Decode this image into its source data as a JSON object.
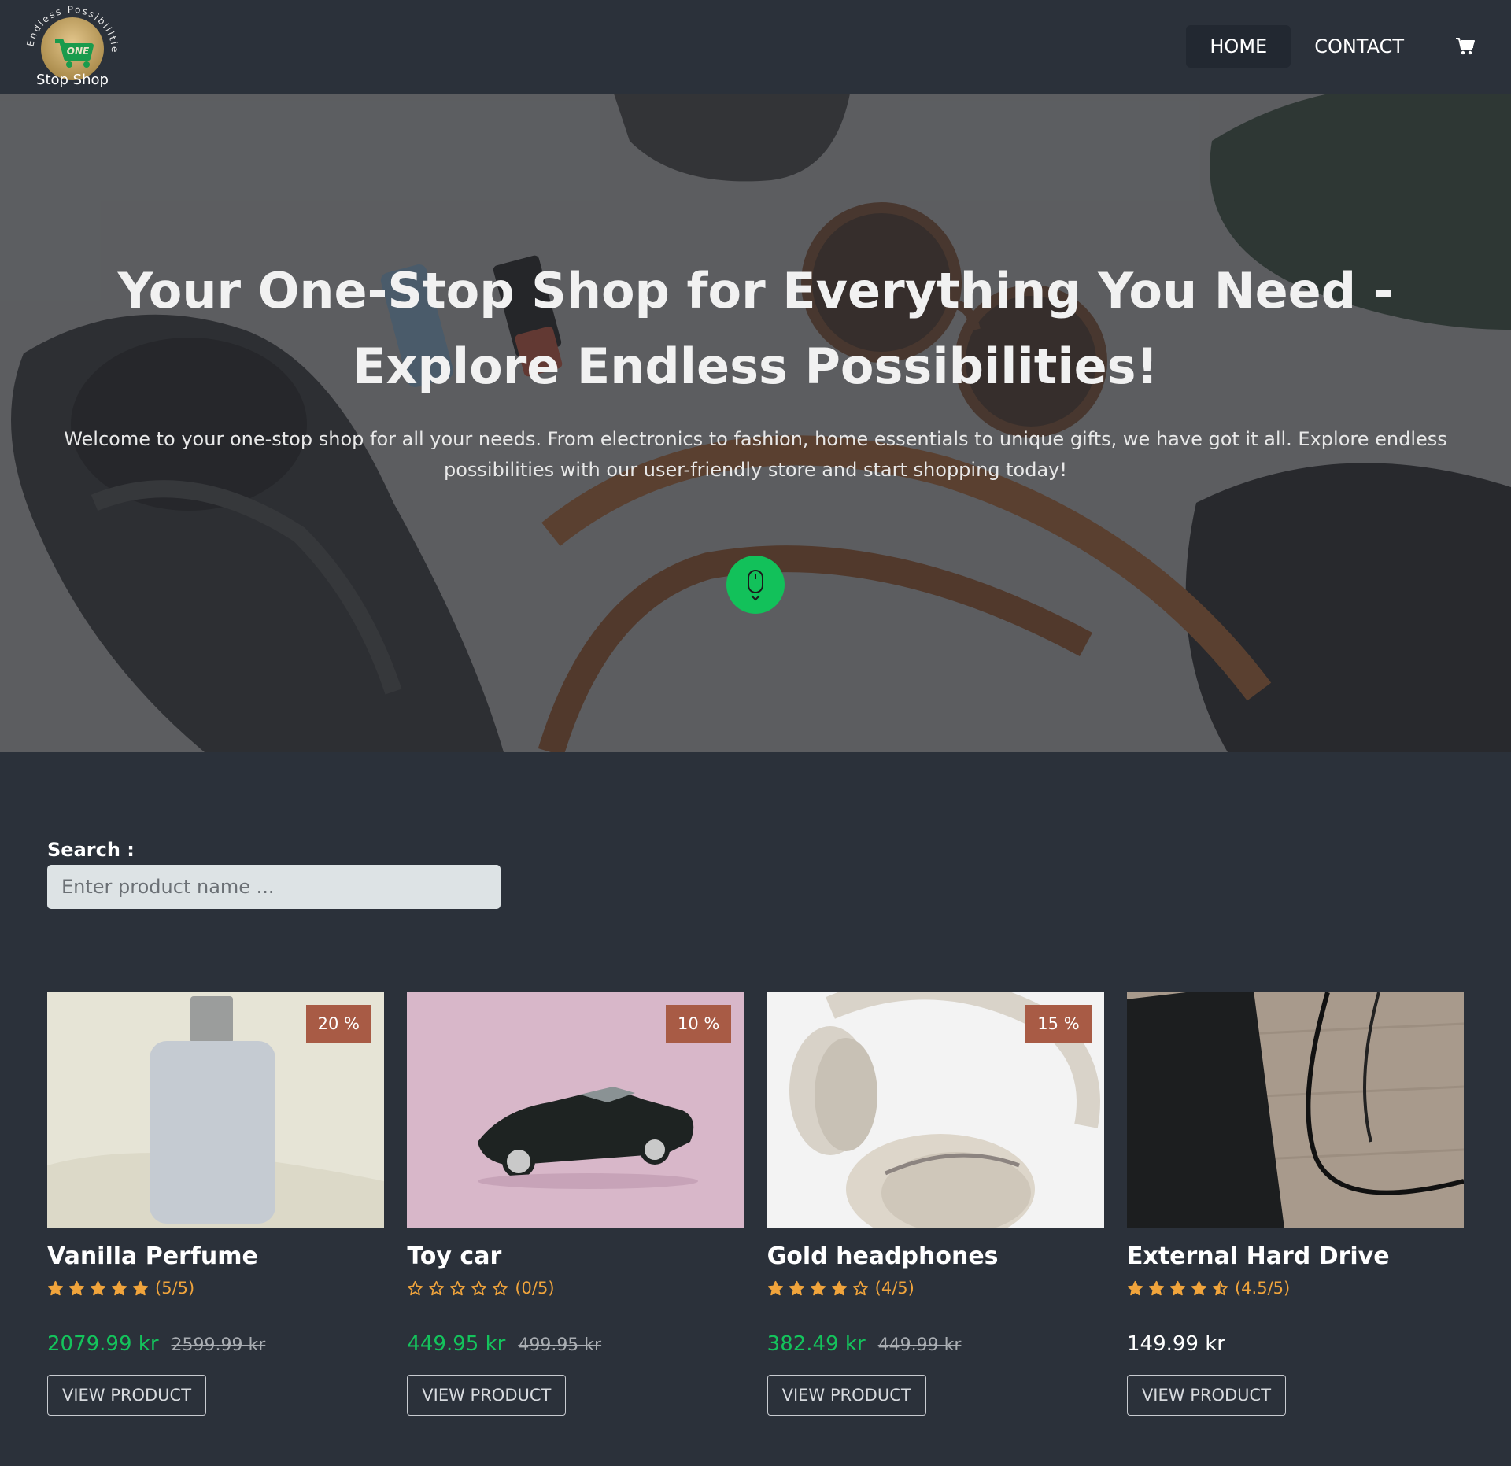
{
  "brand": {
    "arc_text": "Endless Possibilities",
    "badge_text": "ONE",
    "name": "Stop Shop",
    "colors": {
      "gold": "#d3ae6c",
      "green": "#1a9b4c"
    }
  },
  "nav": {
    "items": [
      {
        "label": "HOME",
        "active": true
      },
      {
        "label": "CONTACT",
        "active": false
      }
    ],
    "cart_icon": "shopping-cart-icon"
  },
  "hero": {
    "title": "Your One-Stop Shop for Everything You Need - Explore Endless Possibilities!",
    "text": "Welcome to your one-stop shop for all your needs. From electronics to fashion, home essentials to unique gifts, we have got it all. Explore endless possibilities with our user-friendly store and start shopping today!",
    "scroll_icon": "mouse-scroll-icon"
  },
  "search": {
    "label": "Search :",
    "placeholder": "Enter product name ..."
  },
  "products": [
    {
      "name": "Vanilla Perfume",
      "rating": 5,
      "rating_text": "(5/5)",
      "discount": "20 %",
      "price": "2079.99 kr",
      "old_price": "2599.99 kr",
      "button": "VIEW PRODUCT",
      "image": "perfume-bottle"
    },
    {
      "name": "Toy car",
      "rating": 0,
      "rating_text": "(0/5)",
      "discount": "10 %",
      "price": "449.95 kr",
      "old_price": "499.95 kr",
      "button": "VIEW PRODUCT",
      "image": "toy-car"
    },
    {
      "name": "Gold headphones",
      "rating": 4,
      "rating_text": "(4/5)",
      "discount": "15 %",
      "price": "382.49 kr",
      "old_price": "449.99 kr",
      "button": "VIEW PRODUCT",
      "image": "headphones"
    },
    {
      "name": "External Hard Drive",
      "rating": 4.5,
      "rating_text": "(4.5/5)",
      "discount": "",
      "price": "149.99 kr",
      "old_price": "",
      "button": "VIEW PRODUCT",
      "image": "hard-drive"
    }
  ],
  "colors": {
    "background": "#2b313a",
    "accent_green": "#14c35c",
    "discount_badge": "#a85b45",
    "star": "#f0a43c"
  }
}
